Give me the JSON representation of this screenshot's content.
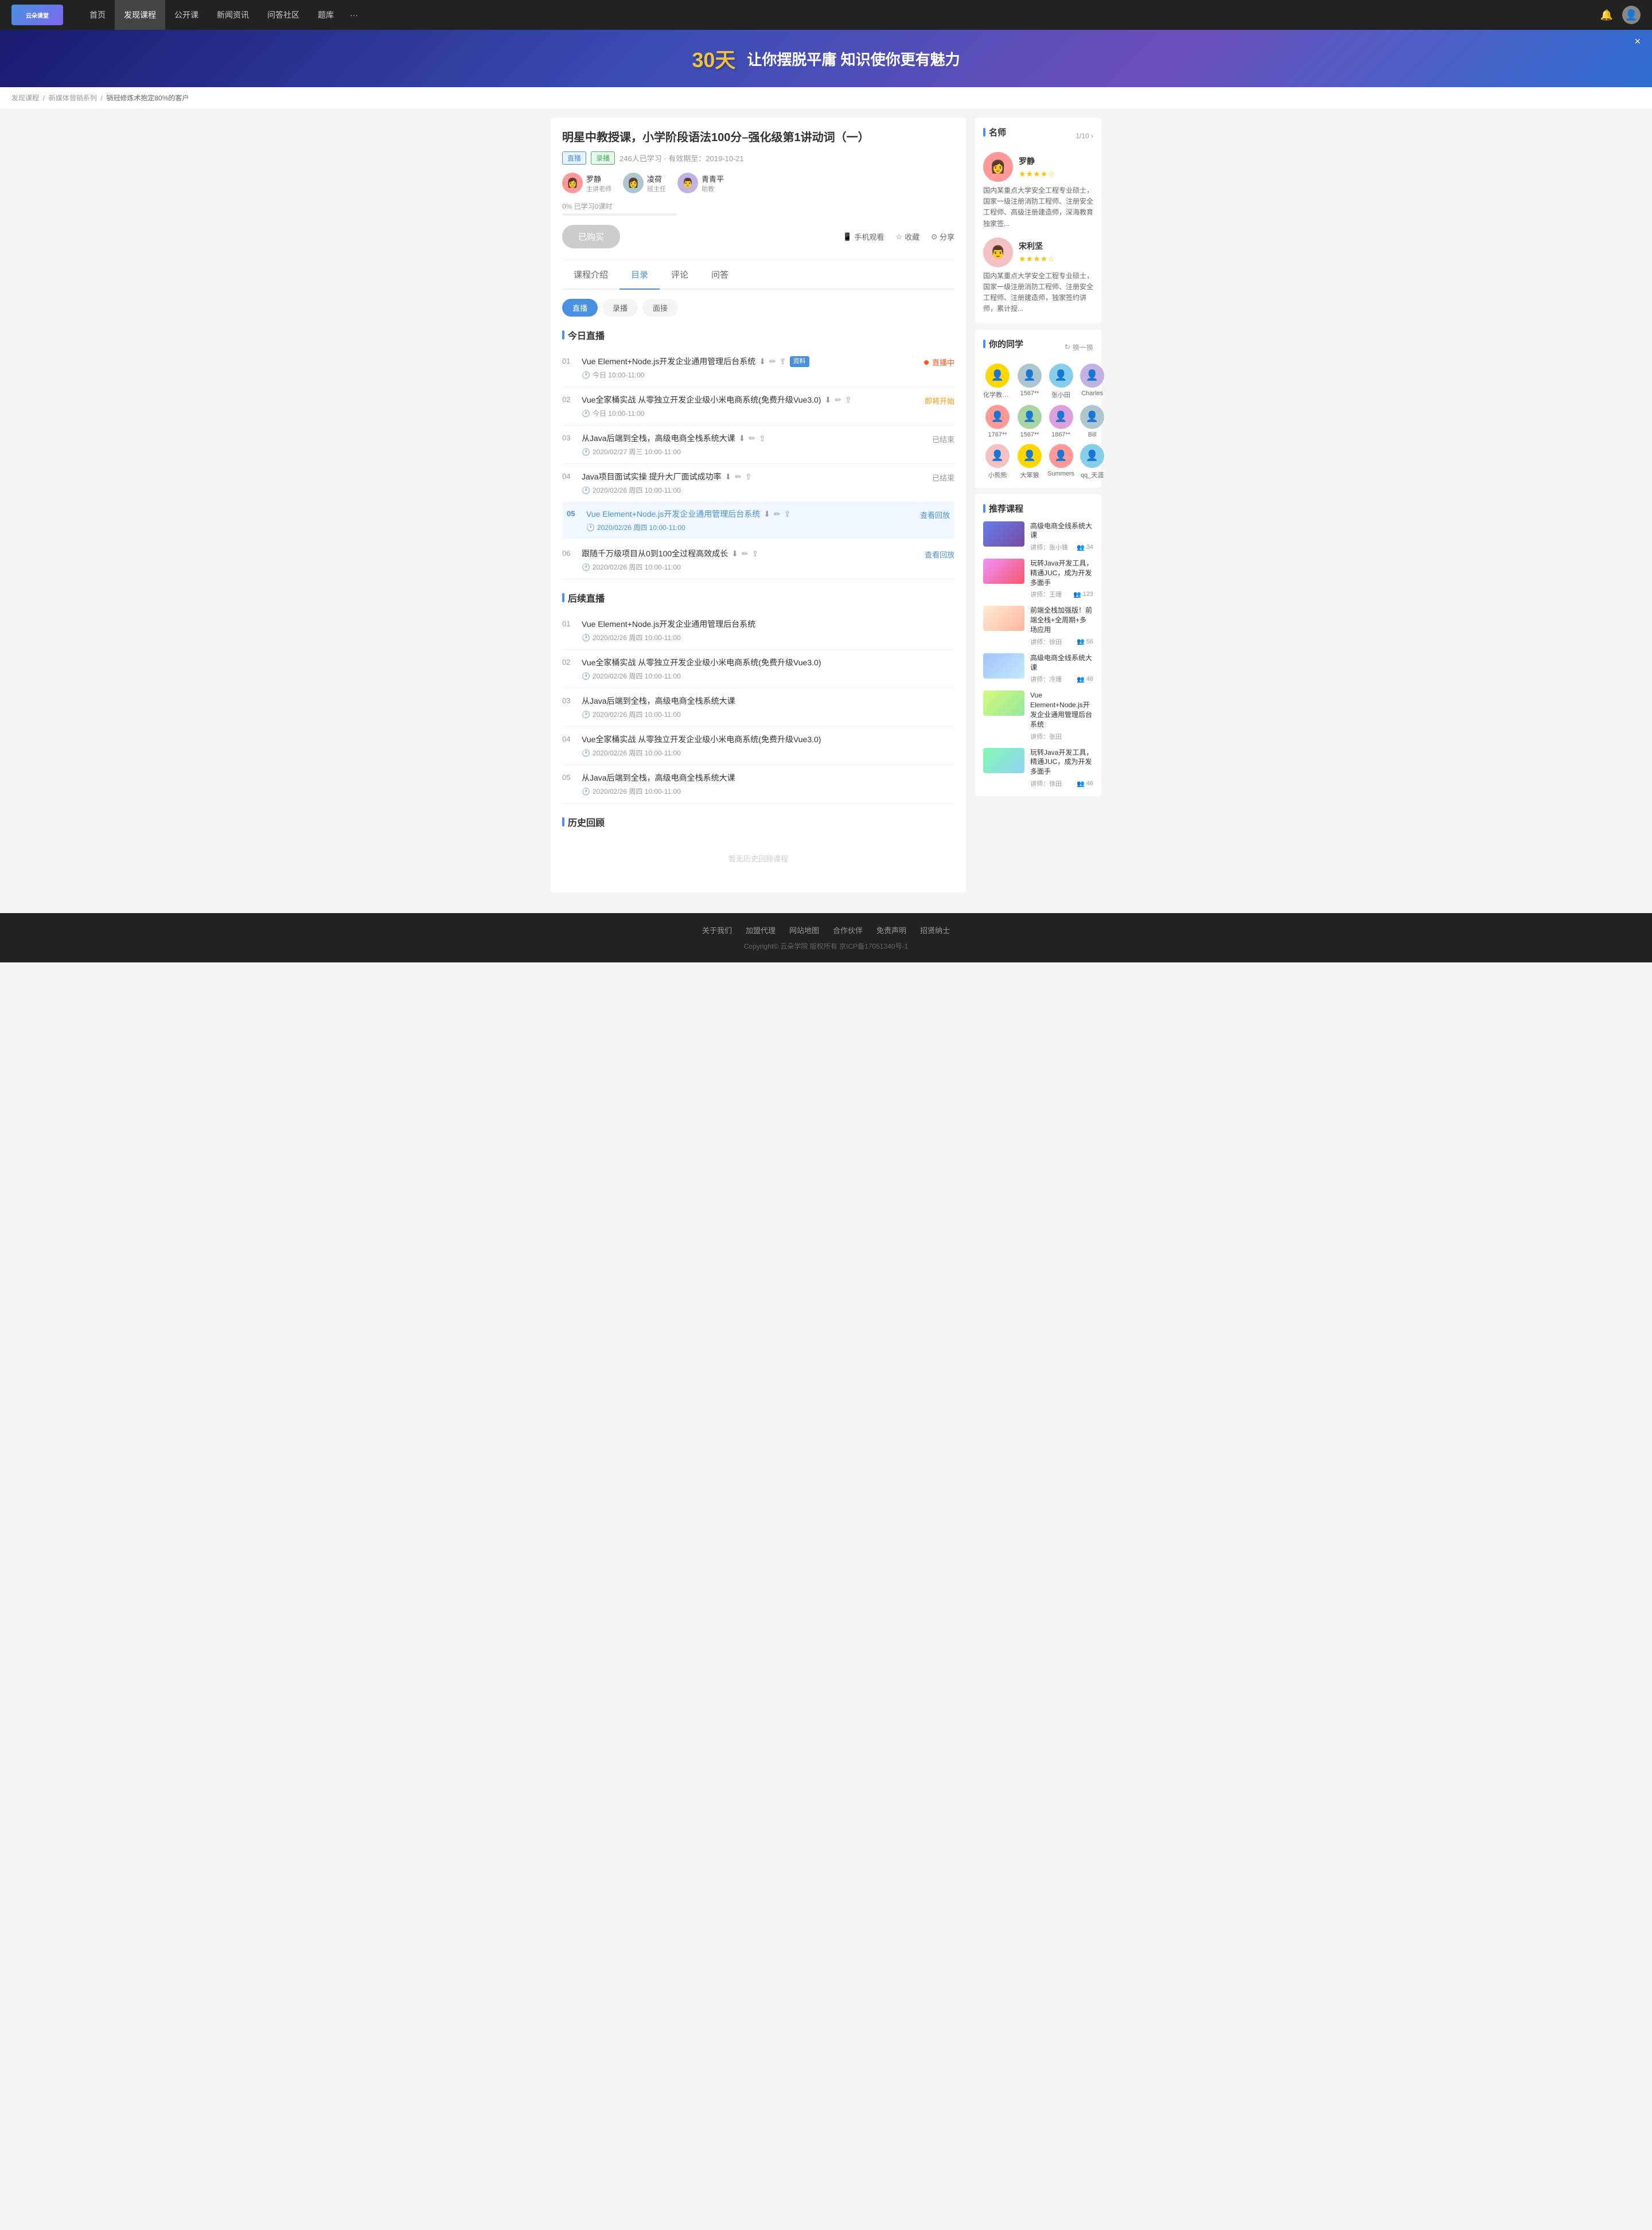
{
  "header": {
    "logo_text": "云朵课堂",
    "nav_items": [
      "首页",
      "发现课程",
      "公开课",
      "新闻资讯",
      "问答社区",
      "题库"
    ],
    "nav_more": "···"
  },
  "banner": {
    "text1": "30天",
    "text2": "让你摆脱平庸 知识使你更有魅力",
    "close": "×"
  },
  "breadcrumb": {
    "items": [
      "发现课程",
      "新媒体营销系列",
      "销冠修炼术抱定80%的客户"
    ]
  },
  "course": {
    "title": "明星中教授课，小学阶段语法100分–强化级第1讲动词（一）",
    "tag_live": "直播",
    "tag_record": "录播",
    "meta": "246人已学习 · 有效期至：2019-10-21",
    "teachers": [
      {
        "name": "罗静",
        "role": "主讲老师",
        "color": "av-color-1"
      },
      {
        "name": "凌荷",
        "role": "班主任",
        "color": "av-color-2"
      },
      {
        "name": "青青平",
        "role": "助教",
        "color": "av-color-3"
      }
    ],
    "progress_label": "0%  已学习0课时",
    "progress_pct": 0,
    "btn_bought": "已购买",
    "btn_mobile": "手机观看",
    "btn_collect": "收藏",
    "btn_share": "分享"
  },
  "tabs": {
    "items": [
      "课程介绍",
      "目录",
      "评论",
      "问答"
    ],
    "active": 1
  },
  "sub_tabs": {
    "items": [
      "直播",
      "录播",
      "面接"
    ],
    "active": 0
  },
  "today_live": {
    "title": "今日直播",
    "items": [
      {
        "num": "01",
        "name": "Vue Element+Node.js开发企业通用管理后台系统",
        "time": "今日 10:00-11:00",
        "status": "直播中",
        "has_material": true,
        "has_icons": true
      },
      {
        "num": "02",
        "name": "Vue全家桶实战 从零独立开发企业级小米电商系统(免费升级Vue3.0)",
        "time": "今日 10:00-11:00",
        "status": "即将开始",
        "has_material": false,
        "has_icons": true
      },
      {
        "num": "03",
        "name": "从Java后端到全栈，高级电商全栈系统大课",
        "time": "2020/02/27 周三 10:00-11:00",
        "status": "已结束",
        "has_material": false,
        "has_icons": true
      },
      {
        "num": "04",
        "name": "Java项目面试实操 提升大厂面试成功率",
        "time": "2020/02/26 周四 10:00-11:00",
        "status": "已结束",
        "has_material": false,
        "has_icons": true
      },
      {
        "num": "05",
        "name": "Vue Element+Node.js开发企业通用管理后台系统",
        "time": "2020/02/26 周四 10:00-11:00",
        "status": "查看回放",
        "highlight": true,
        "has_material": false,
        "has_icons": true
      },
      {
        "num": "06",
        "name": "跟随千万级项目从0到100全过程高效成长",
        "time": "2020/02/26 周四 10:00-11:00",
        "status": "查看回放",
        "has_material": false,
        "has_icons": true
      }
    ]
  },
  "future_live": {
    "title": "后续直播",
    "items": [
      {
        "num": "01",
        "name": "Vue Element+Node.js开发企业通用管理后台系统",
        "time": "2020/02/26 周四 10:00-11:00"
      },
      {
        "num": "02",
        "name": "Vue全家桶实战 从零独立开发企业级小米电商系统(免费升级Vue3.0)",
        "time": "2020/02/26 周四 10:00-11:00"
      },
      {
        "num": "03",
        "name": "从Java后端到全栈，高级电商全栈系统大课",
        "time": "2020/02/26 周四 10:00-11:00"
      },
      {
        "num": "04",
        "name": "Vue全家桶实战 从零独立开发企业级小米电商系统(免费升级Vue3.0)",
        "time": "2020/02/26 周四 10:00-11:00"
      },
      {
        "num": "05",
        "name": "从Java后端到全栈，高级电商全栈系统大课",
        "time": "2020/02/26 周四 10:00-11:00"
      }
    ]
  },
  "history_live": {
    "title": "历史回顾",
    "empty": "暂无历史回顾课程"
  },
  "sidebar": {
    "teacher_title": "名师",
    "teacher_nav": "1/10 ›",
    "teachers": [
      {
        "name": "罗静",
        "stars": 4,
        "desc": "国内某重点大学安全工程专业硕士，国家一级注册消防工程师、注册安全工程师、高级注册建造师，深海教育独家签...",
        "color": "av-color-1"
      },
      {
        "name": "宋利坚",
        "stars": 4,
        "desc": "国内某重点大学安全工程专业硕士，国家一级注册消防工程师、注册安全工程师、注册建造师，独家签约讲师，累计授...",
        "color": "av-color-5"
      }
    ],
    "classmates_title": "你的同学",
    "switch_btn": "换一换",
    "classmates": [
      {
        "name": "化学教书...",
        "color": "av-color-6"
      },
      {
        "name": "1567**",
        "color": "av-color-2"
      },
      {
        "name": "张小田",
        "color": "av-color-7"
      },
      {
        "name": "Charles",
        "color": "av-color-3"
      },
      {
        "name": "1767**",
        "color": "av-color-1"
      },
      {
        "name": "1567**",
        "color": "av-color-4"
      },
      {
        "name": "1867**",
        "color": "av-color-8"
      },
      {
        "name": "Bill",
        "color": "av-color-2"
      },
      {
        "name": "小熊熊",
        "color": "av-color-5"
      },
      {
        "name": "大笨狼",
        "color": "av-color-6"
      },
      {
        "name": "Summers",
        "color": "av-color-1"
      },
      {
        "name": "qq_天涯",
        "color": "av-color-7"
      }
    ],
    "rec_title": "推荐课程",
    "rec_items": [
      {
        "title": "高级电商全线系统大课",
        "lecturer": "讲师：张小锋",
        "students": "34",
        "thumb_class": "rec-thumb-1"
      },
      {
        "title": "玩转Java开发工具，精通JUC，成为开发多面手",
        "lecturer": "讲师：王珊",
        "students": "123",
        "thumb_class": "rec-thumb-2"
      },
      {
        "title": "前端全栈加强版！前端全栈+全周期+多场应用",
        "lecturer": "讲师：徐田",
        "students": "56",
        "thumb_class": "rec-thumb-3"
      },
      {
        "title": "高级电商全线系统大课",
        "lecturer": "讲师：冷珊",
        "students": "46",
        "thumb_class": "rec-thumb-4"
      },
      {
        "title": "Vue Element+Node.js开发企业通用管理后台系统",
        "lecturer": "讲师：张田",
        "students": "",
        "thumb_class": "rec-thumb-5"
      },
      {
        "title": "玩转Java开发工具，精通JUC，成为开发多面手",
        "lecturer": "讲师：徐田",
        "students": "46",
        "thumb_class": "rec-thumb-6"
      }
    ]
  },
  "footer": {
    "links": [
      "关于我们",
      "加盟代理",
      "网站地图",
      "合作伙伴",
      "免责声明",
      "招贤纳士"
    ],
    "copyright": "Copyright© 云朵学院  版权所有   京ICP备17051340号-1"
  }
}
